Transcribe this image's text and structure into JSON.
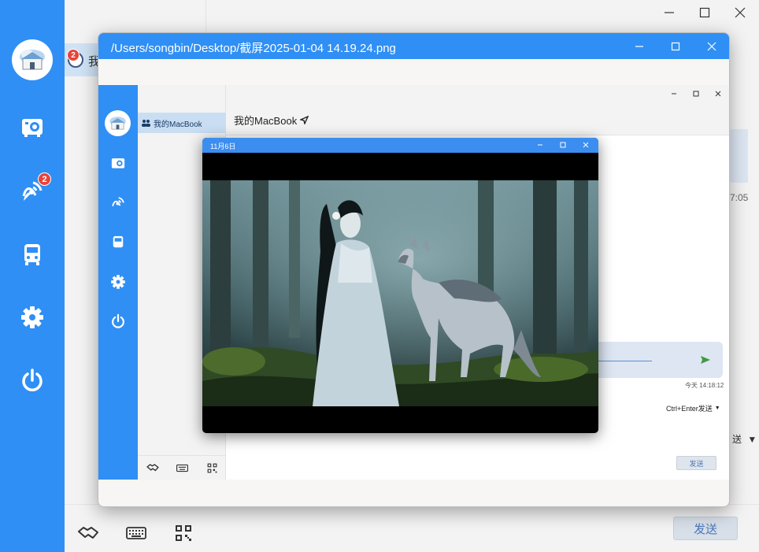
{
  "app": {
    "conversation_preview": "我",
    "notification_count": "2",
    "bg_time_fragment": "7:05",
    "dropdown_fragment": "送",
    "send_label": "发送"
  },
  "viewer": {
    "title": "/Users/songbin/Desktop/截屏2025-01-04 14.19.24.png"
  },
  "screenshot": {
    "list_item": "我的MacBook",
    "chat_title": "我的MacBook",
    "message_time": "今天 14:18:12",
    "send_mode": "Ctrl+Enter发送",
    "send_label": "发送"
  },
  "popup": {
    "title": "11月6日"
  },
  "colors": {
    "accent": "#2f8ff5",
    "badge": "#e8443a",
    "send_text": "#4a76b8"
  }
}
